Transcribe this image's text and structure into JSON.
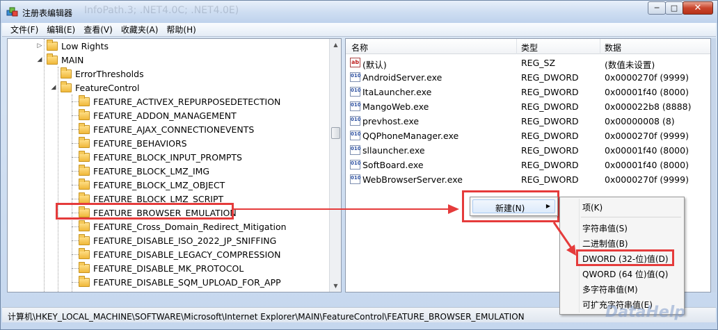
{
  "window": {
    "title": "注册表编辑器",
    "ghost_text": "InfoPath.3; .NET4.0C; .NET4.0E)",
    "buttons": {
      "minimize": "─",
      "maximize": "□",
      "close": "✕"
    }
  },
  "menubar": [
    "文件(F)",
    "编辑(E)",
    "查看(V)",
    "收藏夹(A)",
    "帮助(H)"
  ],
  "tree": {
    "parents": [
      {
        "label": "Low Rights",
        "expander": "▷"
      },
      {
        "label": "MAIN",
        "expander": "◢"
      },
      {
        "label": "ErrorThresholds",
        "expander": ""
      },
      {
        "label": "FeatureControl",
        "expander": "◢"
      }
    ],
    "features": [
      "FEATURE_ACTIVEX_REPURPOSEDETECTION",
      "FEATURE_ADDON_MANAGEMENT",
      "FEATURE_AJAX_CONNECTIONEVENTS",
      "FEATURE_BEHAVIORS",
      "FEATURE_BLOCK_INPUT_PROMPTS",
      "FEATURE_BLOCK_LMZ_IMG",
      "FEATURE_BLOCK_LMZ_OBJECT",
      "FEATURE_BLOCK_LMZ_SCRIPT",
      "FEATURE_BROWSER_EMULATION",
      "FEATURE_Cross_Domain_Redirect_Mitigation",
      "FEATURE_DISABLE_ISO_2022_JP_SNIFFING",
      "FEATURE_DISABLE_LEGACY_COMPRESSION",
      "FEATURE_DISABLE_MK_PROTOCOL",
      "FEATURE_DISABLE_SQM_UPLOAD_FOR_APP"
    ],
    "selected_index": 8
  },
  "list": {
    "columns": [
      "名称",
      "类型",
      "数据"
    ],
    "rows": [
      {
        "icon": "ab",
        "name": "(默认)",
        "type": "REG_SZ",
        "data": "(数值未设置)"
      },
      {
        "icon": "010",
        "name": "AndroidServer.exe",
        "type": "REG_DWORD",
        "data": "0x0000270f (9999)"
      },
      {
        "icon": "010",
        "name": "ItaLauncher.exe",
        "type": "REG_DWORD",
        "data": "0x00001f40 (8000)"
      },
      {
        "icon": "010",
        "name": "MangoWeb.exe",
        "type": "REG_DWORD",
        "data": "0x000022b8 (8888)"
      },
      {
        "icon": "010",
        "name": "prevhost.exe",
        "type": "REG_DWORD",
        "data": "0x00000008 (8)"
      },
      {
        "icon": "010",
        "name": "QQPhoneManager.exe",
        "type": "REG_DWORD",
        "data": "0x0000270f (9999)"
      },
      {
        "icon": "010",
        "name": "sllauncher.exe",
        "type": "REG_DWORD",
        "data": "0x00001f40 (8000)"
      },
      {
        "icon": "010",
        "name": "SoftBoard.exe",
        "type": "REG_DWORD",
        "data": "0x00001f40 (8000)"
      },
      {
        "icon": "010",
        "name": "WebBrowserServer.exe",
        "type": "REG_DWORD",
        "data": "0x0000270f (9999)"
      }
    ]
  },
  "context_menu": {
    "new_label": "新建(N)",
    "arrow": "▶"
  },
  "submenu": {
    "key": "项(K)",
    "items": [
      "字符串值(S)",
      "二进制值(B)",
      "DWORD (32-位)值(D)",
      "QWORD (64 位)值(Q)",
      "多字符串值(M)",
      "可扩充字符串值(E)"
    ],
    "highlighted_index": 2
  },
  "statusbar": {
    "path": "计算机\\HKEY_LOCAL_MACHINE\\SOFTWARE\\Microsoft\\Internet Explorer\\MAIN\\FeatureControl\\FEATURE_BROWSER_EMULATION"
  },
  "watermark": "DataHelp",
  "colors": {
    "annotation": "#e53b3b",
    "folder": "#f0b83a"
  }
}
